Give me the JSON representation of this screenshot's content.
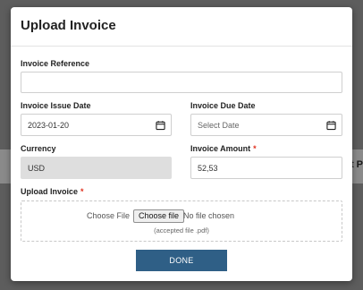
{
  "background": {
    "partial_text": "t P"
  },
  "modal": {
    "title": "Upload Invoice",
    "invoice_reference": {
      "label": "Invoice Reference",
      "value": ""
    },
    "issue_date": {
      "label": "Invoice Issue Date",
      "value": "2023-01-20",
      "icon": "calendar-icon"
    },
    "due_date": {
      "label": "Invoice Due Date",
      "placeholder": "Select Date",
      "icon": "calendar-icon"
    },
    "currency": {
      "label": "Currency",
      "value": "USD"
    },
    "amount": {
      "label": "Invoice Amount",
      "required_mark": "*",
      "value": "52,53"
    },
    "upload": {
      "label": "Upload Invoice",
      "required_mark": "*",
      "choose_label": "Choose File",
      "choose_button": "Choose file",
      "no_file_text": "No file chosen",
      "accepted_text": "(accepted file .pdf)"
    },
    "done_button": "DONE"
  },
  "colors": {
    "primary_button": "#2f5f86",
    "required": "#e0301e",
    "readonly_field": "#dedede"
  }
}
